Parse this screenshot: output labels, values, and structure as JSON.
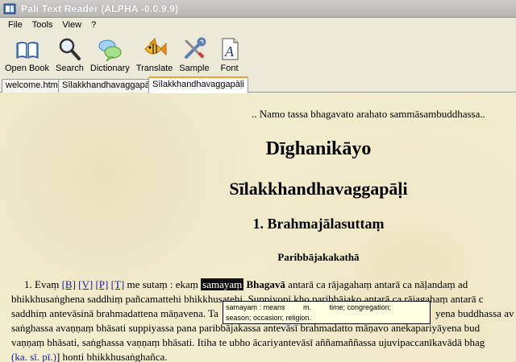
{
  "window": {
    "title": "Pali Text Reader (ALPHA -0.0.9.9)"
  },
  "menu": [
    "File",
    "Tools",
    "View",
    "?"
  ],
  "toolbar": [
    {
      "label": "Open Book",
      "icon": "open-book-icon"
    },
    {
      "label": "Search",
      "icon": "magnifier-icon"
    },
    {
      "label": "Dictionary",
      "icon": "speech-bubbles-icon"
    },
    {
      "label": "Translate",
      "icon": "fish-icon"
    },
    {
      "label": "Sample",
      "icon": "tools-icon"
    },
    {
      "label": "Font",
      "icon": "font-icon"
    }
  ],
  "tabs": [
    {
      "label": "welcome.htm",
      "active": false
    },
    {
      "label": "Sīlakkhandhavaggapāḷi",
      "active": false
    },
    {
      "label": "Sīlakkhandhavaggapāḷi",
      "active": true
    }
  ],
  "document": {
    "namo": ".. Namo tassa bhagavato arahato sammāsambuddhassa..",
    "title1": "Dīghanikāyo",
    "title2": "Sīlakkhandhavaggapāḷi",
    "title3": "1. Brahmajālasuttaṃ",
    "title4": "Paribbājakakathā",
    "p1_start": "1. Evaṃ ",
    "ref_b": "[B]",
    "ref_v": "[V]",
    "ref_p": "[P]",
    "ref_t": "[T]",
    "p1_mid": " me sutaṃ : ekaṃ ",
    "highlight_word": "samayaṃ",
    "bhagava": "Bhagavā",
    "p1_end": " antarā ca rājagahaṃ antarā ca nāḷandaṃ ad",
    "line2": "bhikkhusaṅghena saddhiṃ pañcamattehi bhikkhusatehi. Suppiyopi kho paribbājako antarā ca rājagahaṃ antarā c",
    "line3_a": "saddhiṃ antevāsinā brahmadattena māṇavena. Ta",
    "line3_b": "yena buddhassa av",
    "line4": "saṅghassa avaṇṇaṃ bhāsati suppiyassa pana paribbājakassa antevāsī brahmadatto māṇavo anekapariyāyena bud",
    "line5": "vaṇṇaṃ bhāsati, saṅghassa vaṇṇaṃ bhāsati. Itiha te ubho ācariyantevāsī aññamaññassa ujuvipaccanīkavādā bhag",
    "line6_ref": "(ka. sī. pī.)",
    "line6_end": "] honti bhikkhusaṅghañca."
  },
  "tooltip": {
    "line1": "samayaṃ : means         m.         time; congregation;",
    "line2": "season; occasion; religion."
  },
  "colors": {
    "page_bg": "#f3edcf",
    "link": "#1a1aa6",
    "tab_accent": "#f0a030"
  }
}
